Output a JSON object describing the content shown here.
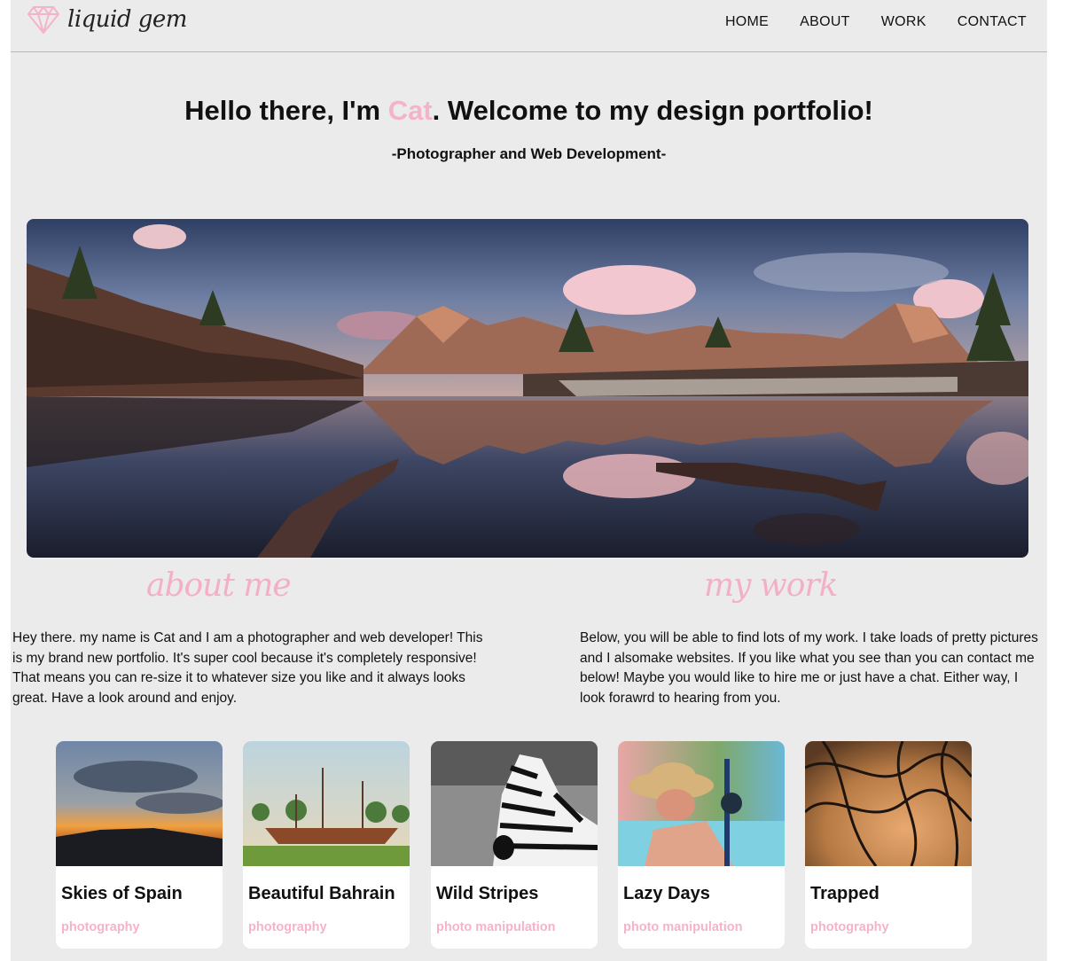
{
  "brand": {
    "name": "liquid gem",
    "accent_color": "#f5b3c8",
    "logo_icon": "diamond-icon"
  },
  "nav": [
    {
      "label": "HOME"
    },
    {
      "label": "ABOUT"
    },
    {
      "label": "WORK"
    },
    {
      "label": "CONTACT"
    }
  ],
  "hero": {
    "title_prefix": "Hello there, I'm ",
    "title_name": "Cat",
    "title_suffix": ". Welcome to my design portfolio!",
    "subtitle": "-Photographer and Web Development-"
  },
  "about": {
    "heading": "about me",
    "text": "Hey there. my name is Cat and I am a photographer and web developer! This is my brand new portfolio. It's super cool because it's completely responsive! That means you can re-size it to whatever size you like and it always looks great. Have a look around and enjoy."
  },
  "work": {
    "heading": "my work",
    "text": "Below, you will be able to find lots of my work. I take loads of pretty pictures and I alsomake websites. If you like what you see than you can contact me below! Maybe you would like to hire me or just have a chat. Either way, I look forawrd to hearing from you."
  },
  "cards": [
    {
      "title": "Skies of Spain",
      "tag": "photography"
    },
    {
      "title": "Beautiful Bahrain",
      "tag": "photography"
    },
    {
      "title": "Wild Stripes",
      "tag": "photo manipulation"
    },
    {
      "title": "Lazy Days",
      "tag": "photo manipulation"
    },
    {
      "title": "Trapped",
      "tag": "photography"
    }
  ]
}
